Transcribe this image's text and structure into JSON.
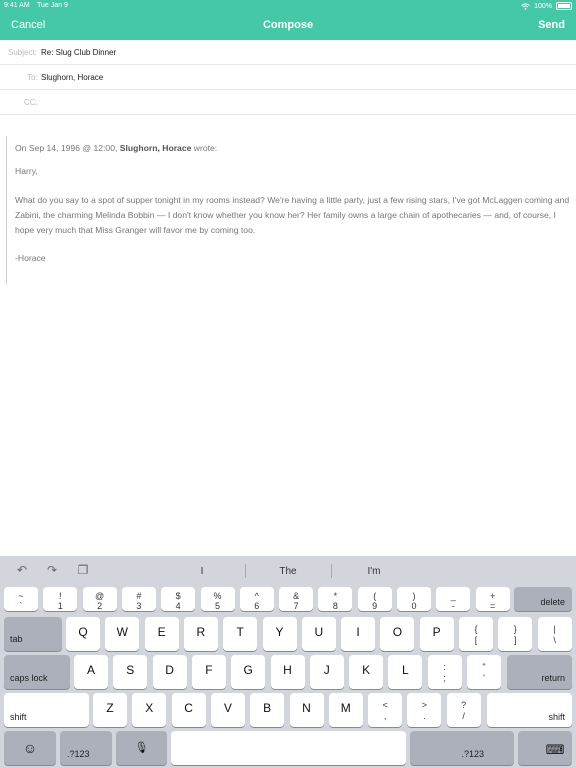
{
  "status": {
    "time": "9:41 AM",
    "date": "Tue Jan 9",
    "battery": "100%"
  },
  "nav": {
    "cancel": "Cancel",
    "title": "Compose",
    "send": "Send"
  },
  "fields": {
    "subject": {
      "label": "Subject:",
      "value": "Re: Slug Club Dinner"
    },
    "to": {
      "label": "To:",
      "value": "Slughorn, Horace"
    },
    "cc": {
      "label": "CC:",
      "value": ""
    }
  },
  "quote": {
    "prefix": "On Sep 14, 1996 @ 12:00,",
    "author": "Slughorn, Horace",
    "suffix": "wrote:",
    "greeting": "Harry,",
    "body": "What do you say to a spot of supper tonight in my rooms instead? We're having a little party, just a few rising stars, I've got McLaggen coming and Zabini, the charming Melinda Bobbin — I don't know whether you know her? Her family owns a large chain of apothecaries — and, of course, I hope very much that Miss Granger will favor me by coming too.",
    "signature": "-Horace"
  },
  "keyboard": {
    "suggestions": [
      "I",
      "The",
      "I'm"
    ],
    "number_row": [
      {
        "up": "~",
        "dn": "`"
      },
      {
        "up": "!",
        "dn": "1"
      },
      {
        "up": "@",
        "dn": "2"
      },
      {
        "up": "#",
        "dn": "3"
      },
      {
        "up": "$",
        "dn": "4"
      },
      {
        "up": "%",
        "dn": "5"
      },
      {
        "up": "^",
        "dn": "6"
      },
      {
        "up": "&",
        "dn": "7"
      },
      {
        "up": "*",
        "dn": "8"
      },
      {
        "up": "(",
        "dn": "9"
      },
      {
        "up": ")",
        "dn": "0"
      },
      {
        "up": "_",
        "dn": "-"
      },
      {
        "up": "+",
        "dn": "="
      }
    ],
    "delete": "delete",
    "tab": "tab",
    "row1": [
      "Q",
      "W",
      "E",
      "R",
      "T",
      "Y",
      "U",
      "I",
      "O",
      "P"
    ],
    "row1_sym": [
      {
        "up": "{",
        "dn": "["
      },
      {
        "up": "}",
        "dn": "]"
      },
      {
        "up": "|",
        "dn": "\\"
      }
    ],
    "caps": "caps lock",
    "row2": [
      "A",
      "S",
      "D",
      "F",
      "G",
      "H",
      "J",
      "K",
      "L"
    ],
    "row2_sym": [
      {
        "up": ":",
        "dn": ";"
      },
      {
        "up": "\"",
        "dn": "'"
      }
    ],
    "return": "return",
    "shift": "shift",
    "row3": [
      "Z",
      "X",
      "C",
      "V",
      "B",
      "N",
      "M"
    ],
    "row3_sym": [
      {
        "up": "<",
        "dn": ","
      },
      {
        "up": ">",
        "dn": "."
      },
      {
        "up": "?",
        "dn": "/"
      }
    ],
    "numkey": ".?123",
    "emoji_icon": "emoji-icon",
    "mic_icon": "microphone-icon",
    "hide_icon": "keyboard-hide-icon"
  },
  "colors": {
    "accent": "#45c8a8"
  }
}
